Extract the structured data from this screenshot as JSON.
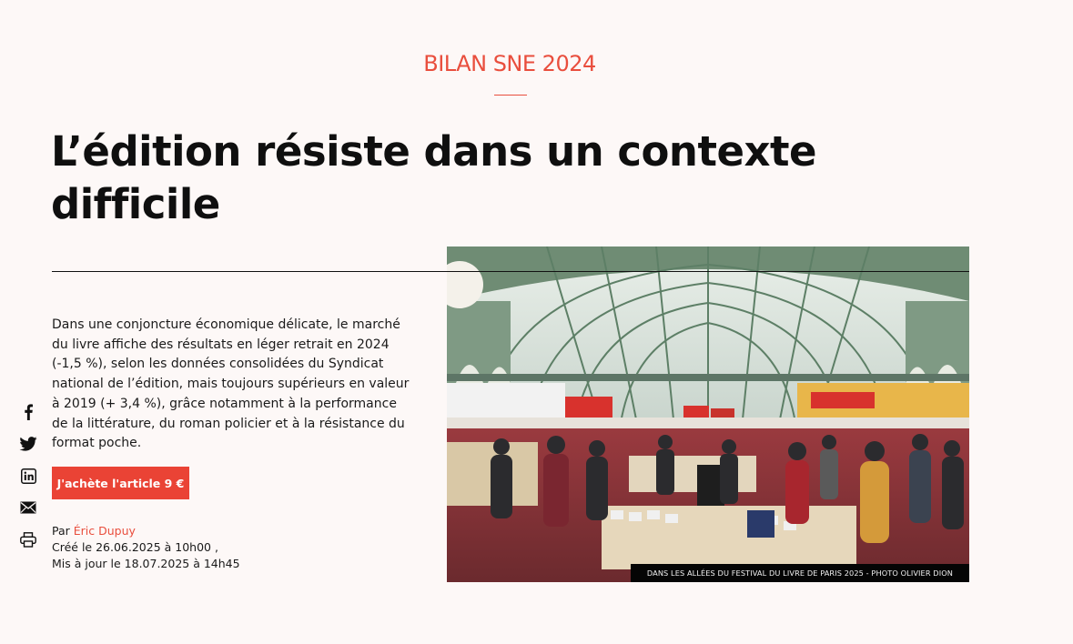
{
  "article": {
    "kicker": "BILAN SNE 2024",
    "headline": "L’édition résiste dans un contexte difficile",
    "chapo": "Dans une conjoncture économique délicate, le marché du livre affiche des résultats en léger retrait en 2024 (-1,5 %), selon les données consolidées du Syndicat national de l’édition, mais toujours supérieurs en valeur à 2019 (+ 3,4 %), grâce notamment à la performance de la littérature, du roman policier et à la résistance du format poche.",
    "buy_label": "J'achète l'article 9 €",
    "byline_prefix": "Par",
    "author": "Éric Dupuy",
    "created": "Créé le 26.06.2025 à 10h00 ,",
    "updated": "Mis à jour le 18.07.2025 à 14h45"
  },
  "photo": {
    "caption": "DANS LES ALLÉES DU FESTIVAL DU LIVRE DE PARIS 2025 - PHOTO OLIVIER DION"
  },
  "share": {
    "icons": [
      "facebook-icon",
      "twitter-icon",
      "linkedin-icon",
      "mail-icon",
      "print-icon"
    ]
  },
  "colors": {
    "accent": "#e94e3d",
    "button": "#ea4335",
    "background": "#fdf8f7",
    "text": "#111111"
  }
}
